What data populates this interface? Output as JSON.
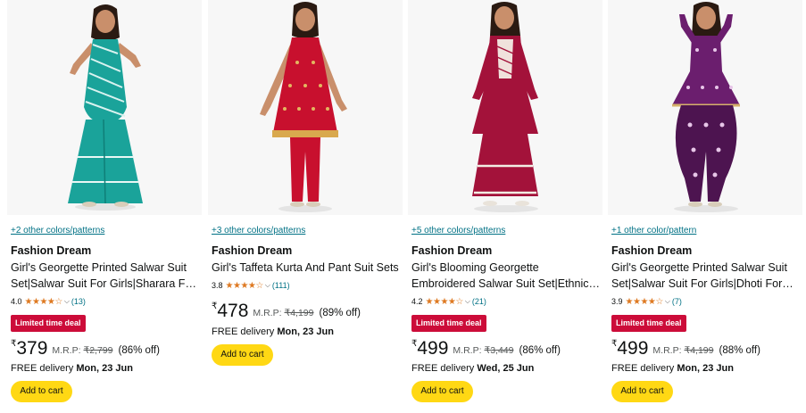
{
  "products": [
    {
      "colors_link": "+2 other colors/patterns",
      "brand": "Fashion Dream",
      "title_line1": "Girl's Georgette Printed Salwar Suit",
      "title_line2": "Set|Salwar Suit For Girls|Sharara For…",
      "rating": "4.0",
      "stars": "★★★★☆",
      "review_count": "(13)",
      "deal_badge": "Limited time deal",
      "currency": "₹",
      "price": "379",
      "mrp_label": "M.R.P:",
      "mrp_value": "₹2,799",
      "discount": "(86% off)",
      "delivery_label": "FREE delivery",
      "delivery_date": "Mon, 23 Jun",
      "add_to_cart": "Add to cart",
      "outfit_color": "#1aa39a"
    },
    {
      "colors_link": "+3 other colors/patterns",
      "brand": "Fashion Dream",
      "title_line1": "Girl's Taffeta Kurta And Pant Suit Sets",
      "title_line2": "",
      "rating": "3.8",
      "stars": "★★★★☆",
      "review_count": "(111)",
      "deal_badge": "",
      "currency": "₹",
      "price": "478",
      "mrp_label": "M.R.P:",
      "mrp_value": "₹4,199",
      "discount": "(89% off)",
      "delivery_label": "FREE delivery",
      "delivery_date": "Mon, 23 Jun",
      "add_to_cart": "Add to cart",
      "outfit_color": "#c8102e"
    },
    {
      "colors_link": "+5 other colors/patterns",
      "brand": "Fashion Dream",
      "title_line1": "Girl's Blooming Georgette",
      "title_line2": "Embroidered Salwar Suit Set|Ethnic…",
      "rating": "4.2",
      "stars": "★★★★☆",
      "review_count": "(21)",
      "deal_badge": "Limited time deal",
      "currency": "₹",
      "price": "499",
      "mrp_label": "M.R.P:",
      "mrp_value": "₹3,449",
      "discount": "(86% off)",
      "delivery_label": "FREE delivery",
      "delivery_date": "Wed, 25 Jun",
      "add_to_cart": "Add to cart",
      "outfit_color": "#a3123a"
    },
    {
      "colors_link": "+1 other color/pattern",
      "brand": "Fashion Dream",
      "title_line1": "Girl's Georgette Printed Salwar Suit",
      "title_line2": "Set|Salwar Suit For Girls|Dhoti For…",
      "rating": "3.9",
      "stars": "★★★★☆",
      "review_count": "(7)",
      "deal_badge": "Limited time deal",
      "currency": "₹",
      "price": "499",
      "mrp_label": "M.R.P:",
      "mrp_value": "₹4,199",
      "discount": "(88% off)",
      "delivery_label": "FREE delivery",
      "delivery_date": "Mon, 23 Jun",
      "add_to_cart": "Add to cart",
      "outfit_color": "#6b1e6e"
    }
  ],
  "colors": {
    "link": "#007185",
    "star": "#de7921",
    "deal_badge": "#cc0c39",
    "cart_button": "#ffd814"
  }
}
